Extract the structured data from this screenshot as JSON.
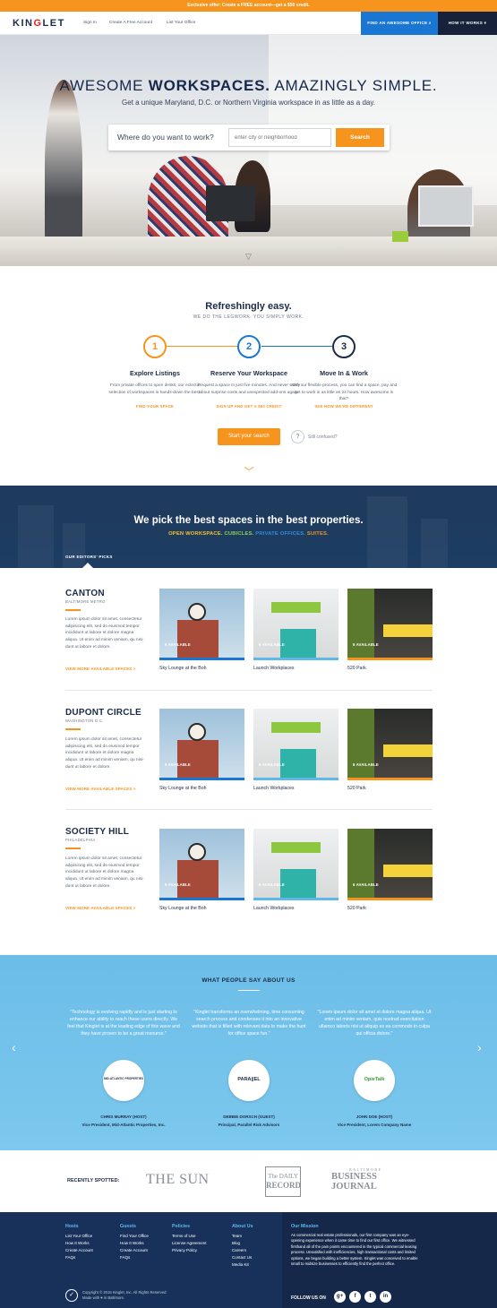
{
  "promo": "Exclusive offer: Create a FREE account—get a $50 credit.",
  "brand": {
    "logo_left": "KIN",
    "logo_accent": "G",
    "logo_right": "LET"
  },
  "nav": {
    "sign_in": "Sign In",
    "create_account": "Create A Free Account",
    "list_office": "List Your Office",
    "find_btn": "FIND AN AWESOME OFFICE",
    "how_btn": "HOW IT WORKS"
  },
  "hero": {
    "title_pre": "AWESOME ",
    "title_bold": "WORKSPACES.",
    "title_post": " AMAZINGLY SIMPLE.",
    "subtitle": "Get a unique Maryland, D.C. or Northern Virginia workspace in as little as a day.",
    "search_label": "Where do you want to work?",
    "search_placeholder": "enter city or neighborhood",
    "search_button": "Search"
  },
  "steps": {
    "title": "Refreshingly easy.",
    "subtitle": "WE DO THE LEGWORK. YOU SIMPLY WORK.",
    "items": [
      {
        "num": "1",
        "title": "Explore Listings",
        "desc": "From private offices to open desks, our eclectic selection of workspaces is hands-down the best.",
        "link": "FIND YOUR SPACE"
      },
      {
        "num": "2",
        "title": "Reserve Your Workspace",
        "desc": "Request a space in just five minutes. And never worry about surprise costs and unexpected add-ons again.",
        "link": "SIGN UP AND GET A $50 CREDIT"
      },
      {
        "num": "3",
        "title": "Move In & Work",
        "desc": "With our flexible process, you can find a space, pay and get to work in as little as 24 hours. How awesome is that?",
        "link": "SEE HOW WE'RE DIFFERENT"
      }
    ],
    "start_button": "Start your search",
    "help_icon": "?",
    "still_confused": "Still confused?"
  },
  "best": {
    "title": "We pick the best spaces in the best properties.",
    "types": [
      {
        "label": "OPEN WORKSPACE.",
        "color": "#f7c325"
      },
      {
        "label": " CUBICLES.",
        "color": "#8fd14f"
      },
      {
        "label": " PRIVATE OFFICES.",
        "color": "#2f8fe0"
      },
      {
        "label": " SUITES.",
        "color": "#f7941d"
      }
    ],
    "picks_label": "OUR EDITORS' PICKS"
  },
  "hoods": [
    {
      "name": "CANTON",
      "city": "BALTIMORE METRO",
      "desc": "Lorem ipsum dolor sit amet, consectetur adipisicing elit, sed do eiusmod tempor incididunt ut labore et dolore magna aliqua. Ut enim ad minim veniam, qu nisi-dunt ut labore et dolore.",
      "link": "VIEW MORE AVAILABLE SPACES >",
      "cards": [
        {
          "badge": "6 AVAILABLE",
          "name": "Sky Lounge at the Boh"
        },
        {
          "badge": "6 AVAILABLE",
          "name": "Launch Workplaces"
        },
        {
          "badge": "6 AVAILABLE",
          "name": "520 Park"
        }
      ]
    },
    {
      "name": "DUPONT CIRCLE",
      "city": "WASHINGTON D.C.",
      "desc": "Lorem ipsum dolor sit amet, consectetur adipisicing elit, sed do eiusmod tempor incididunt ut labore et dolore magna aliqua. Ut enim ad minim veniam, qu nisi-dunt ut labore et dolore.",
      "link": "VIEW MORE AVAILABLE SPACES >",
      "cards": [
        {
          "badge": "6 AVAILABLE",
          "name": "Sky Lounge at the Boh"
        },
        {
          "badge": "6 AVAILABLE",
          "name": "Launch Workplaces"
        },
        {
          "badge": "6 AVAILABLE",
          "name": "520 Park"
        }
      ]
    },
    {
      "name": "SOCIETY HILL",
      "city": "PHILADELPHIA",
      "desc": "Lorem ipsum dolor sit amet, consectetur adipisicing elit, sed do eiusmod tempor incididunt ut labore et dolore magna aliqua. Ut enim ad minim veniam, qu nisi-dunt ut labore et dolore.",
      "link": "VIEW MORE AVAILABLE SPACES >",
      "cards": [
        {
          "badge": "6 AVAILABLE",
          "name": "Sky Lounge at the Boh"
        },
        {
          "badge": "6 AVAILABLE",
          "name": "Launch Workplaces"
        },
        {
          "badge": "6 AVAILABLE",
          "name": "520 Park"
        }
      ]
    }
  ],
  "testimonials": {
    "title": "WHAT PEOPLE SAY ABOUT US",
    "items": [
      {
        "quote": "\"Technology is evolving rapidly and is just starting to enhance our ability to reach these users directly. We feel that Kinglet is at the leading edge of this wave and they have proven to be a great resource.\"",
        "badge": "MID-ATLANTIC PROPERTIES",
        "name": "CHRIS MURRAY (HOST)",
        "role": "Vice President, Mid-Atlantic Properties, Inc."
      },
      {
        "quote": "\"Kinglet transforms an overwhelming, time consuming search process and condenses it into an innovative website that is filled with relevant data to make the hunt for office space fun.\"",
        "badge": "PARA||EL",
        "name": "DEBBIE DORSCH (GUEST)",
        "role": "Principal, Parallel Risk Advisors"
      },
      {
        "quote": "\"Lorem ipsum dolor sit amet et dolore magna aliqua. Ut enim ad minim veniam, quis nostrud exercitation ullamco laboris nisi ut aliquip ex ea commodo in culpa qui officia dolore.\"",
        "badge": "OpieTalk",
        "name": "JOHN DOE (HOST)",
        "role": "Vice President, Lorem Company Name"
      }
    ],
    "prev": "‹",
    "next": "›"
  },
  "press": {
    "label": "RECENTLY SPOTTED:",
    "sun": "THE SUN",
    "daily_top": "The DAILY",
    "daily_bottom": "RECORD",
    "bj_top": "BALTIMORE",
    "bj_bottom": "BUSINESS JOURNAL"
  },
  "footer": {
    "cols": [
      {
        "head": "Hosts",
        "links": [
          "List Your Office",
          "How It Works",
          "Create Account",
          "FAQs"
        ]
      },
      {
        "head": "Guests",
        "links": [
          "Find Your Office",
          "How It Works",
          "Create Account",
          "FAQs"
        ]
      },
      {
        "head": "Policies",
        "links": [
          "Terms of Use",
          "License Agreement",
          "Privacy Policy"
        ]
      },
      {
        "head": "About Us",
        "links": [
          "Team",
          "Blog",
          "Careers",
          "Contact Us",
          "Media Kit"
        ]
      }
    ],
    "mission_head": "Our Mission",
    "mission": "As commercial real estate professionals, our first company was an eye-opening experience when it came time to find our first office. We witnessed firsthand all of the pain points encountered in the typical commercial leasing process. Unsatisfied with inefficiencies, high transactional costs and limited options, we began building a better system. Kinglet was conceived to enable small to midsize businesses to efficiently find the perfect office.",
    "follow": "FOLLOW US ON",
    "social": [
      "g+",
      "f",
      "t",
      "in"
    ],
    "copyright_1": "Copyright © 2015 Kinglet, Inc. All Rights Reserved",
    "copyright_2": "Made with ♥ in Baltimore."
  },
  "colors": {
    "accent": "#f7941d",
    "navy": "#1b2b48",
    "blue": "#1976d2",
    "sky": "#6bbde8"
  }
}
